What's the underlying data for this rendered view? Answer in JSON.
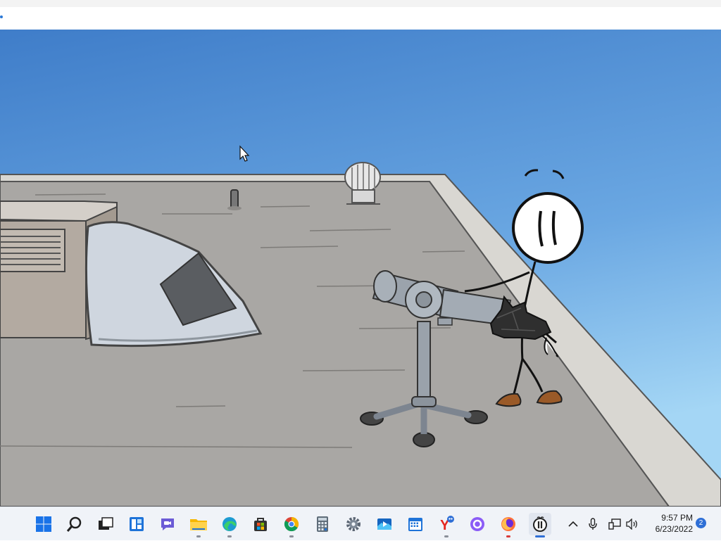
{
  "window": {
    "title": ""
  },
  "scene": {
    "sky_top": "#3f7dc9",
    "sky_bottom": "#9fd2f3",
    "roof_color": "#a9a7a4",
    "roof_edge_color": "#d2d0cb"
  },
  "taskbar": {
    "items": [
      {
        "name": "start",
        "icon": "windows-start-icon"
      },
      {
        "name": "search",
        "icon": "search-icon"
      },
      {
        "name": "task-view",
        "icon": "task-view-icon"
      },
      {
        "name": "widgets",
        "icon": "widgets-icon"
      },
      {
        "name": "chat",
        "icon": "chat-icon"
      },
      {
        "name": "file-explorer",
        "icon": "folder-icon"
      },
      {
        "name": "edge",
        "icon": "edge-icon"
      },
      {
        "name": "store",
        "icon": "store-icon"
      },
      {
        "name": "chrome",
        "icon": "chrome-icon"
      },
      {
        "name": "calculator",
        "icon": "calculator-icon"
      },
      {
        "name": "settings",
        "icon": "gear-icon"
      },
      {
        "name": "media-player",
        "icon": "media-player-icon"
      },
      {
        "name": "calendar",
        "icon": "calendar-icon"
      },
      {
        "name": "yandex",
        "icon": "yandex-icon"
      },
      {
        "name": "assistant",
        "icon": "alice-icon"
      },
      {
        "name": "firefox",
        "icon": "firefox-icon"
      },
      {
        "name": "game",
        "icon": "game-app-icon"
      }
    ],
    "clock": {
      "time": "9:57 PM",
      "date": "6/23/2022"
    },
    "notification_count": "2"
  }
}
